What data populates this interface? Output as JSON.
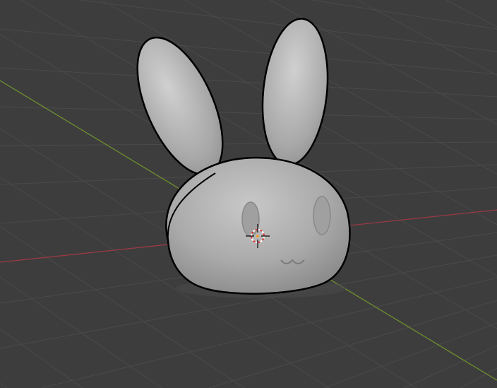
{
  "viewport": {
    "background": "#3d3d3d",
    "grid_color": "#4a4a4a",
    "x_axis_color": "#9a3a44",
    "y_axis_color": "#6e8f2e",
    "object_color": "#b4b4b4",
    "outline_color": "#000000",
    "cursor_icon": "3d-cursor-icon"
  }
}
